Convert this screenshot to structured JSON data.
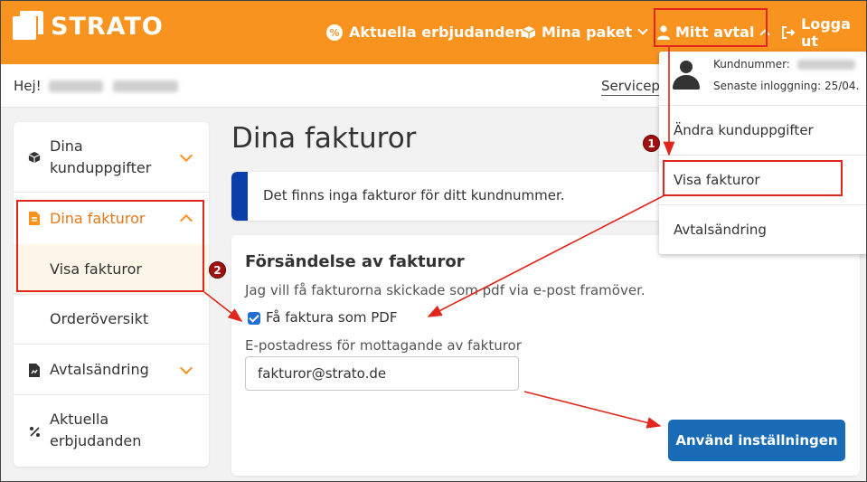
{
  "header": {
    "logo_text": "STRATO",
    "offers_label": "Aktuella erbjudanden",
    "packages_label": "Mina paket",
    "contract_label": "Mitt avtal",
    "logout_label": "Logga ut"
  },
  "greeting": {
    "prefix": "Hej!",
    "service_link": "Servicep"
  },
  "sidebar": {
    "items": [
      {
        "label_line1": "Dina",
        "label_line2": "kunduppgifter",
        "icon": "box-icon"
      },
      {
        "label": "Dina fakturor",
        "icon": "document-icon"
      },
      {
        "label": "Visa fakturor"
      },
      {
        "label": "Orderöversikt"
      },
      {
        "label": "Avtalsändring",
        "icon": "contract-icon"
      },
      {
        "label_line1": "Aktuella",
        "label_line2": "erbjudanden",
        "icon": "percent-icon"
      }
    ]
  },
  "main": {
    "title": "Dina fakturor",
    "notice": "Det finns inga fakturor för ditt kundnummer.",
    "card": {
      "title": "Försändelse av fakturor",
      "description": "Jag vill få fakturorna skickade som pdf via e-post framöver.",
      "checkbox_label": "Få faktura som PDF",
      "email_label": "E-postadress för mottagande av fakturor",
      "email_value": "fakturor@strato.de",
      "apply_button": "Använd inställningen"
    }
  },
  "dropdown": {
    "customer_number_label": "Kundnummer:",
    "last_login": "Senaste inloggning: 25/04.",
    "items": [
      "Ändra kunduppgifter",
      "Visa fakturor",
      "Avtalsändring"
    ]
  },
  "annotations": {
    "marker1": "1",
    "marker2": "2"
  },
  "colors": {
    "brand_orange": "#f7931e",
    "annotation_red": "#e1261c",
    "primary_blue": "#1a6bb5",
    "notice_bar": "#0a3ea8",
    "active_bg": "#fff6ea"
  }
}
